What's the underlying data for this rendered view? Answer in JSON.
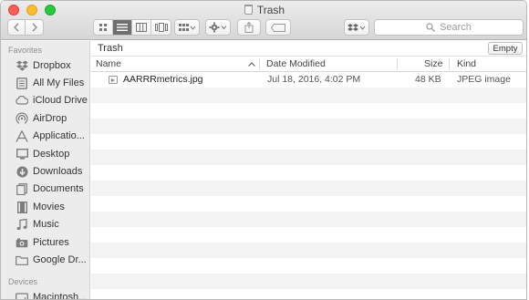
{
  "window": {
    "title": "Trash"
  },
  "toolbar": {
    "back_icon": "chevron-left-icon",
    "forward_icon": "chevron-right-icon",
    "view_modes": [
      "icon-view-icon",
      "list-view-icon",
      "column-view-icon",
      "cover-flow-icon"
    ],
    "active_view": "list-view-icon",
    "search_placeholder": "Search"
  },
  "sidebar": {
    "favorites_heading": "Favorites",
    "items": [
      {
        "label": "Dropbox",
        "icon": "dropbox-icon"
      },
      {
        "label": "All My Files",
        "icon": "all-files-icon"
      },
      {
        "label": "iCloud Drive",
        "icon": "cloud-icon"
      },
      {
        "label": "AirDrop",
        "icon": "airdrop-icon"
      },
      {
        "label": "Applicatio...",
        "icon": "applications-icon"
      },
      {
        "label": "Desktop",
        "icon": "desktop-icon"
      },
      {
        "label": "Downloads",
        "icon": "downloads-icon"
      },
      {
        "label": "Documents",
        "icon": "documents-icon"
      },
      {
        "label": "Movies",
        "icon": "movies-icon"
      },
      {
        "label": "Music",
        "icon": "music-icon"
      },
      {
        "label": "Pictures",
        "icon": "pictures-icon"
      },
      {
        "label": "Google Dr...",
        "icon": "folder-icon"
      }
    ],
    "devices_heading": "Devices",
    "devices": [
      {
        "label": "Macintosh...",
        "icon": "hard-drive-icon"
      }
    ]
  },
  "content": {
    "path_title": "Trash",
    "empty_label": "Empty",
    "columns": {
      "name": "Name",
      "date": "Date Modified",
      "size": "Size",
      "kind": "Kind"
    },
    "files": [
      {
        "name": "AARRRmetrics.jpg",
        "date": "Jul 18, 2016, 4:02 PM",
        "size": "48 KB",
        "kind": "JPEG image"
      }
    ]
  }
}
